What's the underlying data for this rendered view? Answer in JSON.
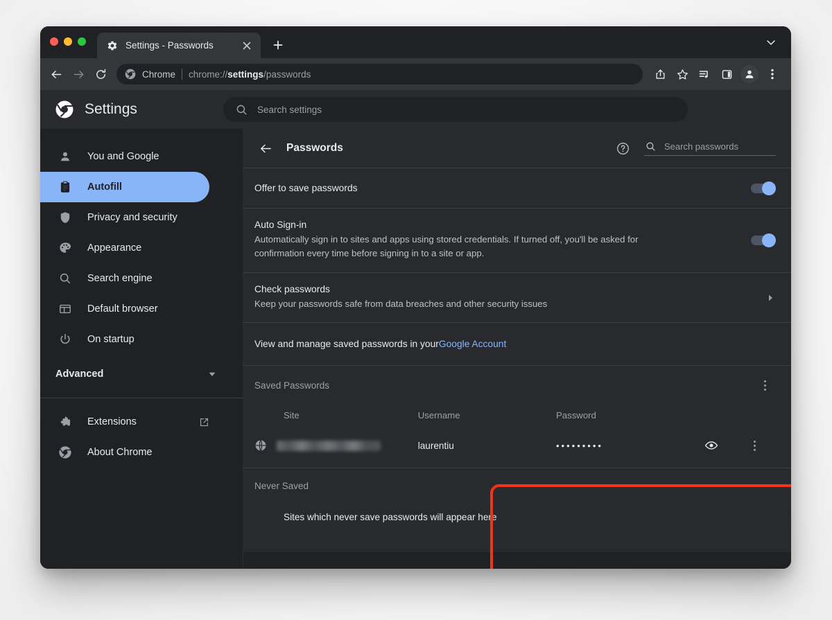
{
  "window": {
    "traffic_lights": [
      "close",
      "minimize",
      "maximize"
    ],
    "colors": {
      "close": "#ff5f57",
      "minimize": "#febc2e",
      "maximize": "#28c840",
      "accent_blue": "#8ab4f8",
      "highlight_red": "#f23416",
      "chrome_surface": "#35363a",
      "settings_bg": "#202124",
      "card_bg": "#292a2d"
    }
  },
  "tabstrip": {
    "active_tab": {
      "title": "Settings - Passwords",
      "favicon": "gear-icon",
      "close_label": "×"
    },
    "new_tab_label": "+",
    "tabstrip_chevron": "chevron-down-icon"
  },
  "toolbar": {
    "back": "back-arrow-icon",
    "forward": "forward-arrow-icon",
    "reload": "reload-icon",
    "omnibox": {
      "badge": "chrome-logo-icon",
      "scheme_label": "Chrome",
      "url_prefix": "chrome://",
      "url_bold": "settings",
      "url_suffix": "/passwords"
    },
    "share": "share-icon",
    "bookmark": "star-icon",
    "media": "media-playlist-icon",
    "side_panel": "side-panel-icon",
    "profile": "profile-avatar-icon",
    "menu": "three-dot-menu-icon"
  },
  "settings_header": {
    "logo": "chrome-logo-icon",
    "title": "Settings",
    "search": {
      "icon": "search-icon",
      "placeholder": "Search settings",
      "value": ""
    }
  },
  "sidebar": {
    "items": [
      {
        "label": "You and Google",
        "icon": "person-icon",
        "active": false
      },
      {
        "label": "Autofill",
        "icon": "clipboard-icon",
        "active": true
      },
      {
        "label": "Privacy and security",
        "icon": "shield-icon",
        "active": false
      },
      {
        "label": "Appearance",
        "icon": "palette-icon",
        "active": false
      },
      {
        "label": "Search engine",
        "icon": "search-icon",
        "active": false
      },
      {
        "label": "Default browser",
        "icon": "browser-window-icon",
        "active": false
      },
      {
        "label": "On startup",
        "icon": "power-icon",
        "active": false
      }
    ],
    "advanced": {
      "label": "Advanced",
      "icon": "chevron-down-icon"
    },
    "footer_items": [
      {
        "label": "Extensions",
        "icon": "puzzle-piece-icon",
        "trailing_icon": "external-link-icon"
      },
      {
        "label": "About Chrome",
        "icon": "chrome-logo-icon",
        "trailing_icon": ""
      }
    ]
  },
  "main": {
    "page_head": {
      "back_icon": "back-arrow-icon",
      "title": "Passwords",
      "help_icon": "help-circle-icon",
      "search": {
        "icon": "search-icon",
        "placeholder": "Search passwords",
        "value": ""
      }
    },
    "offer_to_save": {
      "title": "Offer to save passwords",
      "toggle_on": true
    },
    "auto_signin": {
      "title": "Auto Sign-in",
      "subtitle": "Automatically sign in to sites and apps using stored credentials. If turned off, you'll be asked for confirmation every time before signing in to a site or app.",
      "toggle_on": true
    },
    "check_passwords": {
      "title": "Check passwords",
      "subtitle": "Keep your passwords safe from data breaches and other security issues",
      "chevron": "chevron-right-icon"
    },
    "google_account_row": {
      "text_before": "View and manage saved passwords in your ",
      "link_text": "Google Account"
    },
    "saved_passwords": {
      "section_title": "Saved Passwords",
      "menu_icon": "three-dot-menu-icon",
      "columns": [
        "Site",
        "Username",
        "Password"
      ],
      "rows": [
        {
          "site_icon": "globe-icon",
          "site": "",
          "site_redacted": true,
          "username": "laurentiu",
          "password_mask": "•••••••••",
          "show_icon": "eye-icon",
          "row_menu_icon": "three-dot-menu-icon"
        }
      ]
    },
    "never_saved": {
      "section_title": "Never Saved",
      "empty_text": "Sites which never save passwords will appear here"
    }
  },
  "annotation": {
    "highlight_target": "saved-passwords-section",
    "color": "#f23416"
  }
}
